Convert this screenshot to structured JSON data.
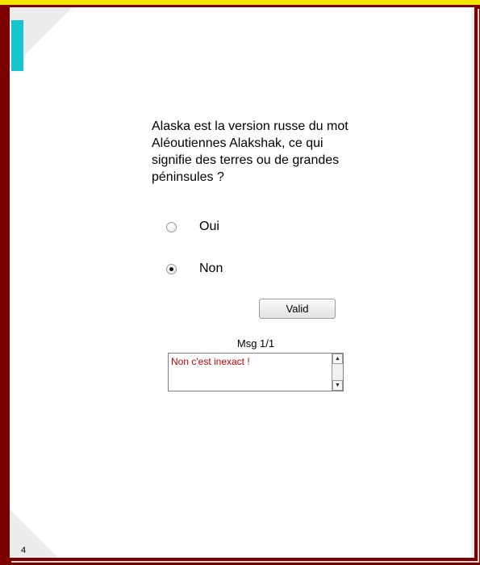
{
  "question": {
    "line1": "Alaska est la version russe du mot",
    "line2": "Aléoutiennes Alakshak, ce qui",
    "line3": "signifie des terres ou de grandes",
    "line4": "péninsules ?"
  },
  "options": [
    {
      "label": "Oui",
      "selected": false
    },
    {
      "label": "Non",
      "selected": true
    }
  ],
  "valid_button_label": "Valid",
  "message_panel": {
    "title": "Msg 1/1",
    "text": "Non c'est inexact !"
  },
  "page_number": "4",
  "colors": {
    "frame": "#7b0000",
    "top_stripe": "#f2e600",
    "accent_tab": "#16c6cf",
    "message_text": "#cc0000"
  },
  "icons": {
    "scroll_up": "up-arrow",
    "scroll_down": "down-arrow"
  }
}
